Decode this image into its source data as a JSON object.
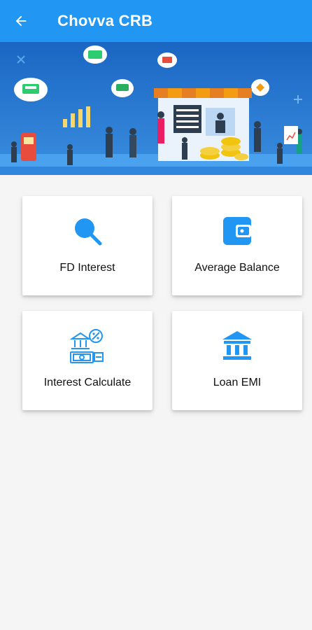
{
  "appbar": {
    "title": "Chovva CRB",
    "back_icon": "arrow-left-icon",
    "color": "#2196f3"
  },
  "banner": {
    "illustration": "banking-people-illustration",
    "background": "#1e73c8",
    "board_text": "$"
  },
  "menu": {
    "items": [
      {
        "label": "FD Interest",
        "icon": "search-icon"
      },
      {
        "label": "Average Balance",
        "icon": "wallet-icon"
      },
      {
        "label": "Interest Calculate",
        "icon": "bank-percent-cash-icon"
      },
      {
        "label": "Loan EMI",
        "icon": "bank-building-icon"
      }
    ],
    "icon_color": "#2196f3"
  }
}
